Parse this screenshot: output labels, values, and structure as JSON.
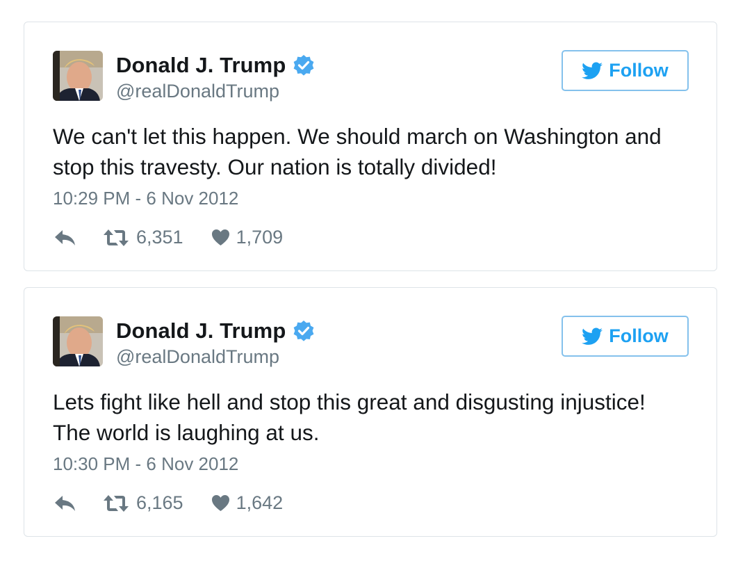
{
  "tweets": [
    {
      "author": {
        "name": "Donald J. Trump",
        "handle": "@realDonaldTrump",
        "verified": true
      },
      "follow_label": "Follow",
      "text_lines": [
        "We can't let this happen. We should march on Washington and",
        "stop this travesty. Our nation is totally divided!"
      ],
      "timestamp": "10:29 PM - 6 Nov 2012",
      "retweets": "6,351",
      "likes": "1,709"
    },
    {
      "author": {
        "name": "Donald J. Trump",
        "handle": "@realDonaldTrump",
        "verified": true
      },
      "follow_label": "Follow",
      "text_lines": [
        "Lets fight like hell and stop this great and disgusting injustice!",
        "The world is laughing at us."
      ],
      "timestamp": "10:30 PM - 6 Nov 2012",
      "retweets": "6,165",
      "likes": "1,642"
    }
  ],
  "icons": {
    "verified": "verified-badge-icon",
    "follow": "twitter-bird-icon",
    "reply": "reply-icon",
    "retweet": "retweet-icon",
    "like": "heart-icon"
  },
  "colors": {
    "accent": "#1da1f2",
    "verified": "#1da1f2",
    "muted_text": "#697882",
    "border": "#dde3e8",
    "follow_border": "#84c1ec",
    "icon_gray": "#697882"
  }
}
